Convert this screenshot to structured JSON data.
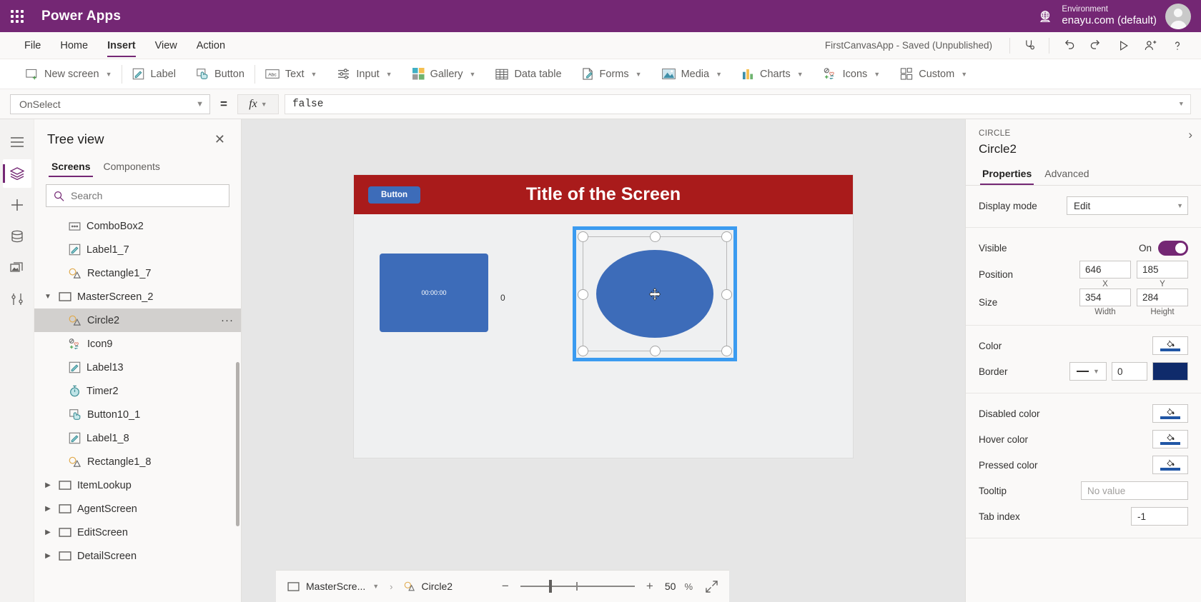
{
  "topbar": {
    "waffle_icon": "app-launcher-icon",
    "brand": "Power Apps",
    "globe_icon": "globe-icon",
    "environment_label": "Environment",
    "environment_name": "enayu.com (default)",
    "avatar_icon": "user-avatar"
  },
  "menubar": {
    "items": [
      {
        "label": "File",
        "active": false
      },
      {
        "label": "Home",
        "active": false
      },
      {
        "label": "Insert",
        "active": true
      },
      {
        "label": "View",
        "active": false
      },
      {
        "label": "Action",
        "active": false
      }
    ],
    "save_status": "FirstCanvasApp - Saved (Unpublished)",
    "tools": [
      {
        "name": "app-checker-icon"
      },
      {
        "name": "undo-icon"
      },
      {
        "name": "redo-icon"
      },
      {
        "name": "preview-play-icon"
      },
      {
        "name": "share-user-icon"
      },
      {
        "name": "help-icon"
      }
    ]
  },
  "ribbon": {
    "items": [
      {
        "label": "New screen",
        "icon": "new-screen-icon",
        "caret": true
      },
      {
        "label": "Label",
        "icon": "label-icon",
        "caret": false
      },
      {
        "label": "Button",
        "icon": "button-icon",
        "caret": false
      },
      {
        "label": "Text",
        "icon": "text-input-icon",
        "caret": true
      },
      {
        "label": "Input",
        "icon": "input-sliders-icon",
        "caret": true
      },
      {
        "label": "Gallery",
        "icon": "gallery-icon",
        "caret": true
      },
      {
        "label": "Data table",
        "icon": "data-table-icon",
        "caret": false
      },
      {
        "label": "Forms",
        "icon": "forms-icon",
        "caret": true
      },
      {
        "label": "Media",
        "icon": "media-image-icon",
        "caret": true
      },
      {
        "label": "Charts",
        "icon": "charts-bar-icon",
        "caret": true
      },
      {
        "label": "Icons",
        "icon": "icons-shapes-icon",
        "caret": true
      },
      {
        "label": "Custom",
        "icon": "custom-component-icon",
        "caret": true
      }
    ]
  },
  "formula_bar": {
    "property": "OnSelect",
    "equals": "=",
    "fx_label": "fx",
    "formula": "false"
  },
  "rail": {
    "items": [
      {
        "name": "hamburger-menu-icon"
      },
      {
        "name": "tree-view-layers-icon",
        "active": true
      },
      {
        "name": "insert-plus-icon"
      },
      {
        "name": "data-cylinder-icon"
      },
      {
        "name": "media-library-icon"
      },
      {
        "name": "advanced-tools-icon"
      }
    ]
  },
  "tree_view": {
    "title": "Tree view",
    "close_icon": "close-icon",
    "tabs": [
      {
        "label": "Screens",
        "active": true
      },
      {
        "label": "Components",
        "active": false
      }
    ],
    "search_placeholder": "Search",
    "search_value": "",
    "search_icon": "search-icon",
    "items": [
      {
        "label": "ComboBox2",
        "icon": "combobox-icon",
        "level": "child",
        "expander": "",
        "selected": false
      },
      {
        "label": "Label1_7",
        "icon": "label-icon",
        "level": "child",
        "expander": "",
        "selected": false
      },
      {
        "label": "Rectangle1_7",
        "icon": "shape-icon",
        "level": "child",
        "expander": "",
        "selected": false
      },
      {
        "label": "MasterScreen_2",
        "icon": "screen-icon",
        "level": "screen",
        "expander": "expanded",
        "selected": false
      },
      {
        "label": "Circle2",
        "icon": "shape-icon",
        "level": "child",
        "expander": "",
        "selected": true,
        "overflow": "···"
      },
      {
        "label": "Icon9",
        "icon": "icons-shapes-icon",
        "level": "child",
        "expander": "",
        "selected": false
      },
      {
        "label": "Label13",
        "icon": "label-icon",
        "level": "child",
        "expander": "",
        "selected": false
      },
      {
        "label": "Timer2",
        "icon": "timer-icon",
        "level": "child",
        "expander": "",
        "selected": false
      },
      {
        "label": "Button10_1",
        "icon": "button-icon",
        "level": "child",
        "expander": "",
        "selected": false
      },
      {
        "label": "Label1_8",
        "icon": "label-icon",
        "level": "child",
        "expander": "",
        "selected": false
      },
      {
        "label": "Rectangle1_8",
        "icon": "shape-icon",
        "level": "child",
        "expander": "",
        "selected": false
      },
      {
        "label": "ItemLookup",
        "icon": "screen-icon",
        "level": "screen",
        "expander": "collapsed",
        "selected": false
      },
      {
        "label": "AgentScreen",
        "icon": "screen-icon",
        "level": "screen",
        "expander": "collapsed",
        "selected": false
      },
      {
        "label": "EditScreen",
        "icon": "screen-icon",
        "level": "screen",
        "expander": "collapsed",
        "selected": false
      },
      {
        "label": "DetailScreen",
        "icon": "screen-icon",
        "level": "screen",
        "expander": "collapsed",
        "selected": false
      }
    ]
  },
  "canvas": {
    "screen_title": "Title of the Screen",
    "button_label": "Button",
    "timer_text": "00:00:00",
    "zero_label": "0",
    "header_color": "#a91b1b",
    "control_color": "#3d6cb9",
    "selection_color": "#3b9bf0",
    "move_cursor_icon": "move-cursor-icon"
  },
  "bottombar": {
    "breadcrumb_screen": "MasterScre...",
    "breadcrumb_screen_icon": "screen-icon",
    "breadcrumb_caret": "chevron-down-icon",
    "breadcrumb_sep": "›",
    "breadcrumb_control": "Circle2",
    "breadcrumb_control_icon": "shape-icon",
    "zoom_minus": "−",
    "zoom_plus": "+",
    "zoom_value": "50",
    "zoom_unit": "%",
    "fit_icon": "fit-screen-icon"
  },
  "properties": {
    "kind": "CIRCLE",
    "name": "Circle2",
    "collapse_icon": "chevron-right-icon",
    "tabs": [
      {
        "label": "Properties",
        "active": true
      },
      {
        "label": "Advanced",
        "active": false
      }
    ],
    "display_mode": {
      "label": "Display mode",
      "value": "Edit"
    },
    "visible": {
      "label": "Visible",
      "state": "On"
    },
    "position": {
      "label": "Position",
      "x": "646",
      "y": "185",
      "x_sub": "X",
      "y_sub": "Y"
    },
    "size": {
      "label": "Size",
      "width": "354",
      "height": "284",
      "width_sub": "Width",
      "height_sub": "Height"
    },
    "color": {
      "label": "Color",
      "swatch_color": "#2156a5",
      "icon": "paint-bucket-icon"
    },
    "border": {
      "label": "Border",
      "style_icon": "line-style-icon",
      "width": "0",
      "color": "#0f2b6b"
    },
    "disabled_color": {
      "label": "Disabled color",
      "swatch_color": "#2156a5",
      "icon": "paint-bucket-icon"
    },
    "hover_color": {
      "label": "Hover color",
      "swatch_color": "#2156a5",
      "icon": "paint-bucket-icon"
    },
    "pressed_color": {
      "label": "Pressed color",
      "swatch_color": "#2156a5",
      "icon": "paint-bucket-icon"
    },
    "tooltip": {
      "label": "Tooltip",
      "placeholder": "No value",
      "value": ""
    },
    "tab_index": {
      "label": "Tab index",
      "value": "-1"
    }
  }
}
